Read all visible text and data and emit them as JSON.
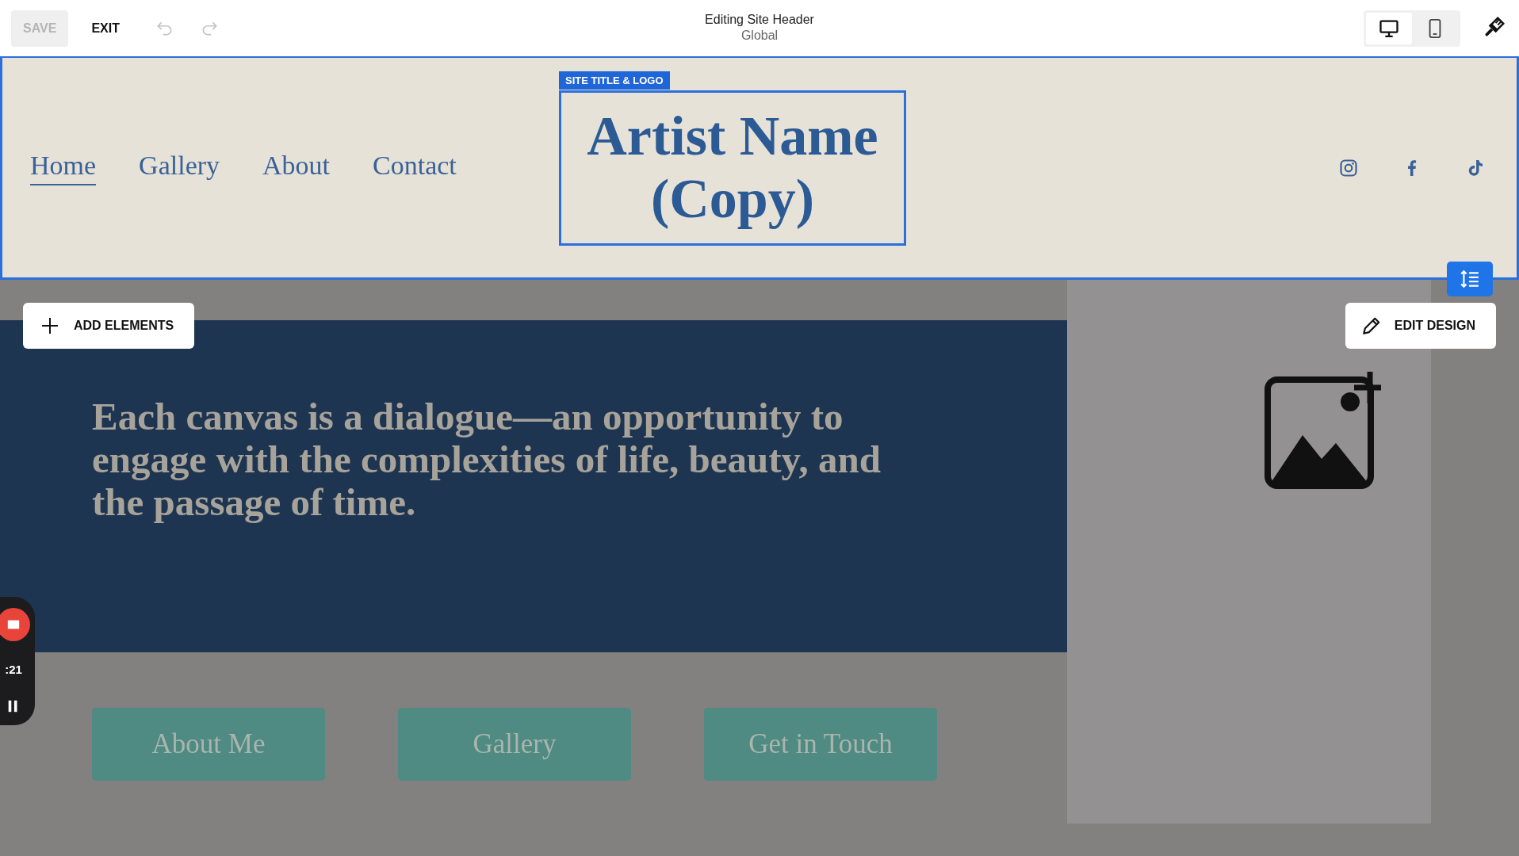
{
  "toolbar": {
    "save": {
      "label": "SAVE",
      "disabled": true
    },
    "exit": "EXIT",
    "undo": {
      "disabled": true
    },
    "redo": {
      "disabled": true
    }
  },
  "editing": {
    "title": "Editing Site Header",
    "subtitle": "Global"
  },
  "view_modes": [
    {
      "kind": "desktop",
      "selected": true
    },
    {
      "kind": "mobile",
      "selected": false
    }
  ],
  "header": {
    "nav": [
      {
        "label": "Home",
        "selected": true
      },
      {
        "label": "Gallery",
        "selected": false
      },
      {
        "label": "About",
        "selected": false
      },
      {
        "label": "Contact",
        "selected": false
      }
    ],
    "site_title_label": "SITE TITLE & LOGO",
    "site_title": "Artist Name (Copy)",
    "social": [
      {
        "kind": "instagram"
      },
      {
        "kind": "facebook"
      },
      {
        "kind": "tiktok"
      }
    ]
  },
  "add_elements": "ADD ELEMENTS",
  "edit_design": "EDIT DESIGN",
  "quote": "Each canvas is a dialogue—an opportunity to engage with the complexities of life, beauty, and the passage of time.",
  "buttons": [
    "About Me",
    "Gallery",
    "Get in Touch"
  ],
  "recorder": {
    "time": ":21"
  }
}
